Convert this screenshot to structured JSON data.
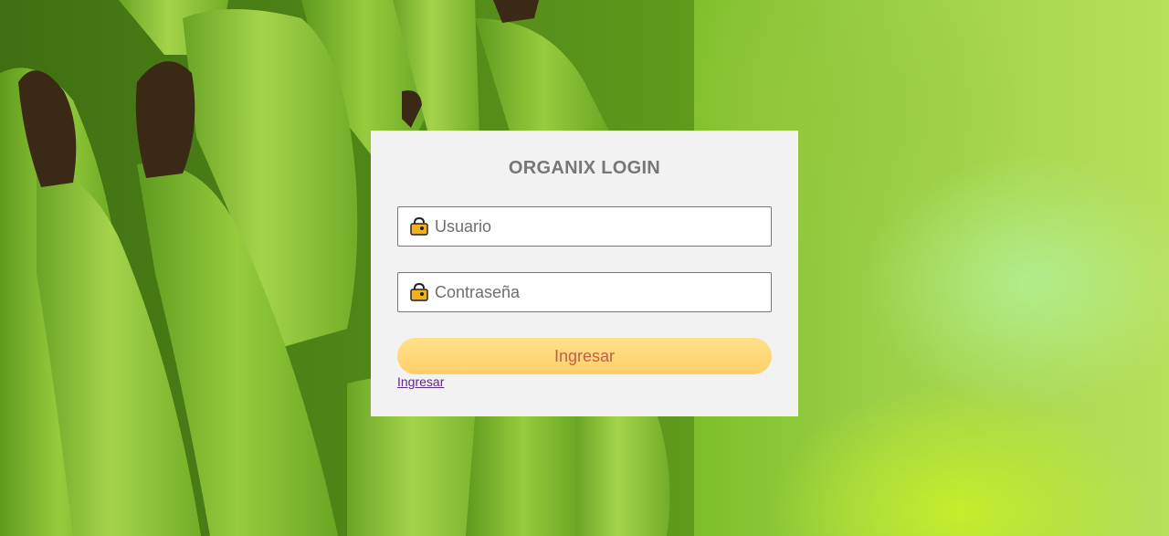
{
  "login": {
    "title": "ORGANIX LOGIN",
    "username_placeholder": "Usuario",
    "password_placeholder": "Contraseña",
    "submit_label": "Ingresar",
    "link_label": "Ingresar"
  },
  "icons": {
    "username": "user-lock-icon",
    "password": "lock-icon"
  },
  "colors": {
    "card_bg": "#f2f2f2",
    "title": "#777777",
    "button_bg": "#ffd57a",
    "button_text": "#c0604a",
    "link": "#5b2a86"
  }
}
